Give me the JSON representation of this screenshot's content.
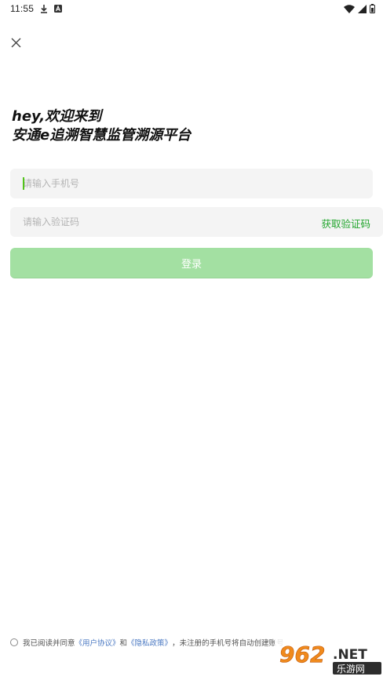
{
  "status_bar": {
    "time": "11:55"
  },
  "headline": {
    "line1": "hey,欢迎来到",
    "line2": "安通e追溯智慧监管溯源平台"
  },
  "form": {
    "phone_placeholder": "请输入手机号",
    "code_placeholder": "请输入验证码",
    "get_code_label": "获取验证码",
    "login_label": "登录"
  },
  "agreement": {
    "prefix": "我已阅读并同意",
    "user_agreement": "《用户协议》",
    "and": "和",
    "privacy_policy": "《隐私政策》",
    "suffix": "，未注册的手机号将自动创建账号"
  },
  "watermark": {
    "number": "962",
    "suffix": ".NET",
    "site": "乐游网"
  },
  "colors": {
    "accent": "#21a52c",
    "button_disabled": "#a3e0a2",
    "link": "#4a78c2"
  }
}
